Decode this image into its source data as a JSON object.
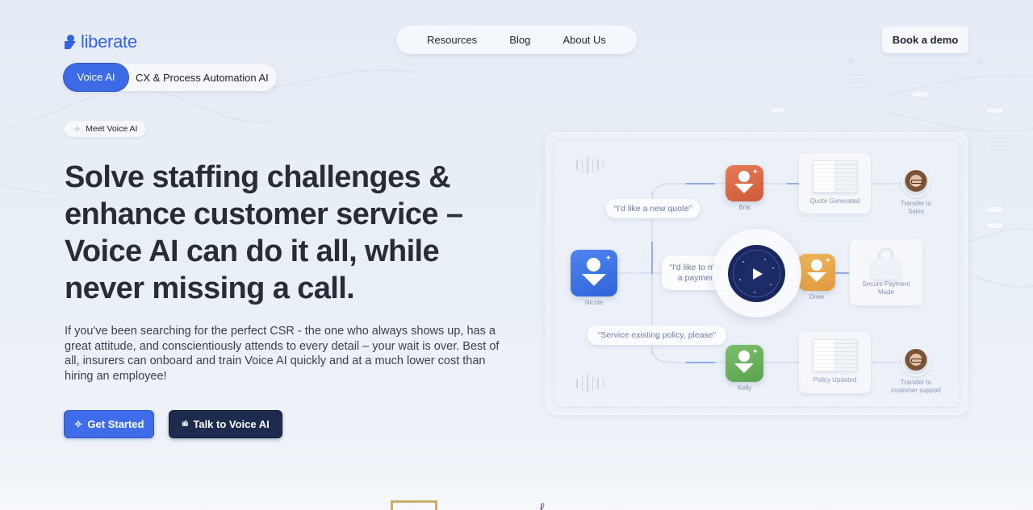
{
  "header": {
    "logo_text": "liberate",
    "nav": [
      "Resources",
      "Blog",
      "About Us"
    ],
    "cta": "Book a demo"
  },
  "product_toggle": {
    "active": "Voice AI",
    "inactive": "CX & Process Automation AI"
  },
  "hero": {
    "badge": "Meet Voice AI",
    "title": "Solve staffing challenges & enhance customer service – Voice AI can do it all, while never missing a call.",
    "description": "If you've been searching for the perfect CSR - the one who always shows up, has a great attitude, and conscientiously attends to every detail – your wait is over. Best of all, insurers can onboard and train Voice AI quickly and at a much lower cost than hiring an employee!",
    "primary_button": "Get Started",
    "secondary_button": "Talk to Voice AI"
  },
  "diagram": {
    "agents": [
      {
        "name": "Nicole",
        "color": "#3e74e8"
      },
      {
        "name": "Bria",
        "color": "#db6a45"
      },
      {
        "name": "Drew",
        "color": "#e7a74a"
      },
      {
        "name": "Kelly",
        "color": "#6bb25e"
      }
    ],
    "bubbles": [
      "“I'd like a new quote”",
      "“I'd like to make a payment”",
      "“Service existing policy, please”"
    ],
    "outcomes": [
      "Quote Generated",
      "Secure Payment Made",
      "Policy Updated"
    ],
    "transfers": [
      "Transfer to Sales",
      "Transfer to customer support"
    ],
    "play_label": "play"
  },
  "colors": {
    "brand": "#3363e0",
    "primary_button": "#3f6ce8",
    "secondary_button": "#1f2b4e"
  }
}
